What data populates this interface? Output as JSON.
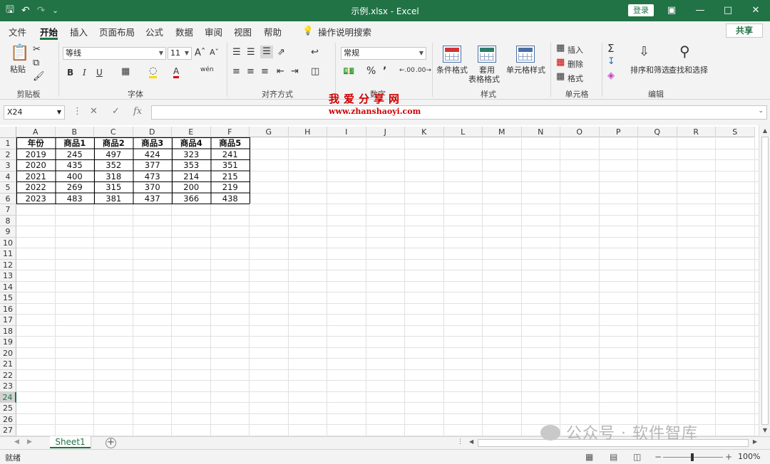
{
  "window": {
    "title": "示例.xlsx  -  Excel",
    "login_label": "登录",
    "accent": "#217346"
  },
  "tabs": [
    "文件",
    "开始",
    "插入",
    "页面布局",
    "公式",
    "数据",
    "审阅",
    "视图",
    "帮助"
  ],
  "active_tab": "开始",
  "tell_me": "操作说明搜索",
  "share_label": "共享",
  "ribbon": {
    "clipboard": {
      "paste": "粘贴",
      "label": "剪贴板"
    },
    "font": {
      "family": "等线",
      "size": "11",
      "label": "字体"
    },
    "alignment": {
      "label": "对齐方式"
    },
    "number": {
      "format": "常规",
      "label": "数字"
    },
    "styles": {
      "conditional": "条件格式",
      "table_line1": "套用",
      "table_line2": "表格格式",
      "cell_styles": "单元格样式",
      "label": "样式"
    },
    "cells": {
      "insert": "插入",
      "delete": "删除",
      "format": "格式",
      "label": "单元格"
    },
    "editing": {
      "sort": "排序和筛选",
      "find": "查找和选择",
      "label": "编辑"
    }
  },
  "name_box": "X24",
  "watermark": {
    "line1": "我爱分享网",
    "line2": "www.zhanshaoyi.com"
  },
  "columns": [
    "A",
    "B",
    "C",
    "D",
    "E",
    "F",
    "G",
    "H",
    "I",
    "J",
    "K",
    "L",
    "M",
    "N",
    "O",
    "P",
    "Q",
    "R",
    "S"
  ],
  "rows": [
    "1",
    "2",
    "3",
    "4",
    "5",
    "6",
    "7",
    "8",
    "9",
    "10",
    "11",
    "12",
    "13",
    "14",
    "15",
    "16",
    "17",
    "18",
    "19",
    "20",
    "21",
    "22",
    "23",
    "24",
    "25",
    "26",
    "27"
  ],
  "selected_row": "24",
  "table": {
    "header": [
      "年份",
      "商品1",
      "商品2",
      "商品3",
      "商品4",
      "商品5"
    ],
    "rows": [
      [
        "2019",
        "245",
        "497",
        "424",
        "323",
        "241"
      ],
      [
        "2020",
        "435",
        "352",
        "377",
        "353",
        "351"
      ],
      [
        "2021",
        "400",
        "318",
        "473",
        "214",
        "215"
      ],
      [
        "2022",
        "269",
        "315",
        "370",
        "200",
        "219"
      ],
      [
        "2023",
        "483",
        "381",
        "437",
        "366",
        "438"
      ]
    ]
  },
  "sheet_tab": "Sheet1",
  "status": {
    "ready": "就绪",
    "zoom": "100%"
  },
  "wechat_mark": "公众号 · 软件智库"
}
